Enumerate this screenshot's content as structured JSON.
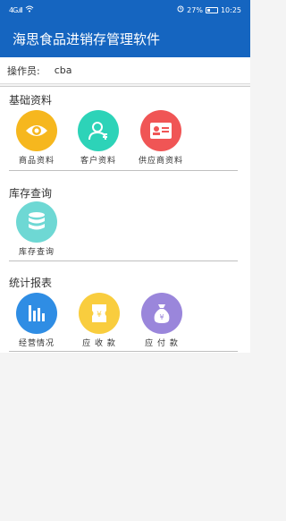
{
  "status": {
    "signal": "4G.ıll",
    "battery": "27%",
    "time": "10:25"
  },
  "app": {
    "title": "海思食品进销存管理软件"
  },
  "user": {
    "label": "操作员:",
    "value": "cba"
  },
  "sections": [
    {
      "title": "基础资料",
      "items": [
        {
          "label": "商品资料",
          "icon": "eye-icon",
          "color": "#f6b71e"
        },
        {
          "label": "客户资料",
          "icon": "person-icon",
          "color": "#2dd3b8"
        },
        {
          "label": "供应商资料",
          "icon": "id-card-icon",
          "color": "#f05555"
        }
      ]
    },
    {
      "title": "库存查询",
      "items": [
        {
          "label": "库存查询",
          "icon": "database-icon",
          "color": "#6ed8d4"
        }
      ]
    },
    {
      "title": "统计报表",
      "items": [
        {
          "label": "经营情况",
          "icon": "bar-chart-icon",
          "color": "#2f8de4"
        },
        {
          "label": "应 收 款",
          "icon": "ticket-icon",
          "color": "#f9cd3e"
        },
        {
          "label": "应 付 款",
          "icon": "money-bag-icon",
          "color": "#9a86db"
        }
      ]
    }
  ]
}
